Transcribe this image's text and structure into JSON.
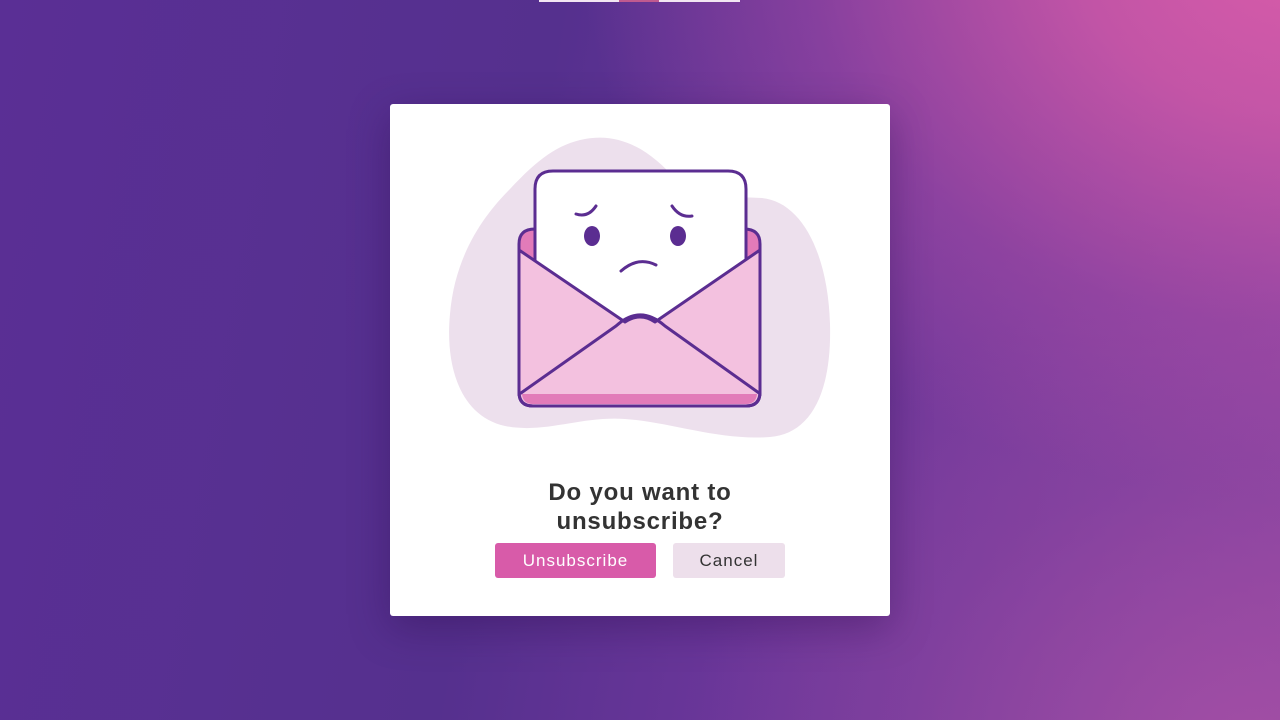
{
  "dialog": {
    "title": "Do you want to unsubscribe?",
    "unsubscribe_label": "Unsubscribe",
    "cancel_label": "Cancel"
  },
  "illustration": {
    "icon": "sad-envelope-icon"
  },
  "colors": {
    "accent": "#d85ba9",
    "secondary_button": "#eddfeb",
    "outline": "#5b2d91",
    "envelope": "#f3c1df",
    "blob": "#ede0ed"
  }
}
